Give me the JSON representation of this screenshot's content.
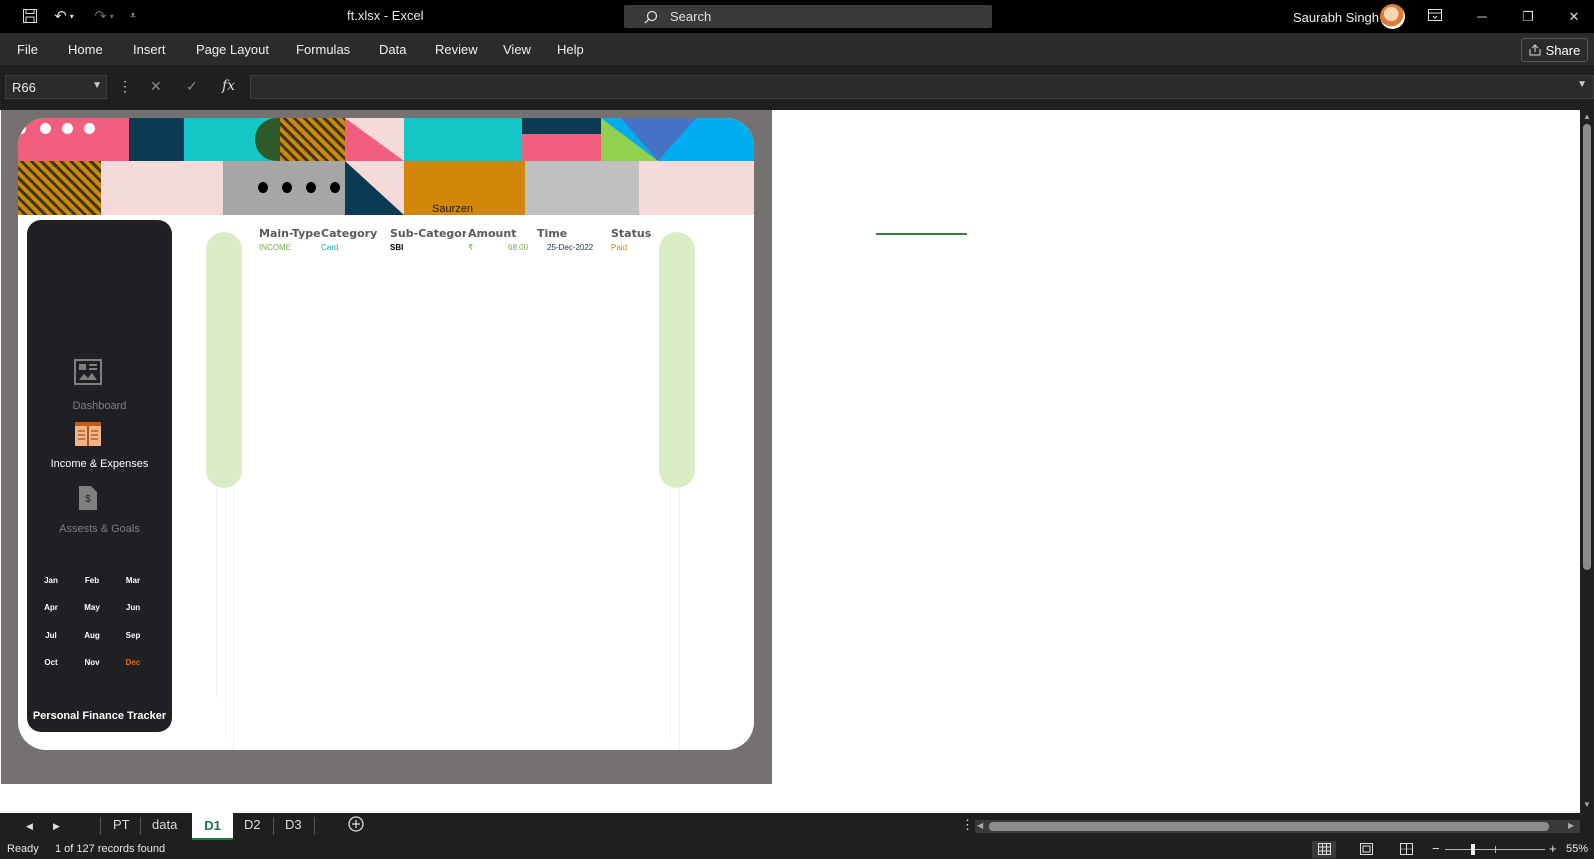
{
  "titlebar": {
    "doc_title": "ft.xlsx  -  Excel",
    "search_label": "Search",
    "user_name": "Saurabh Singh"
  },
  "ribbon": {
    "tabs": [
      "File",
      "Home",
      "Insert",
      "Page Layout",
      "Formulas",
      "Data",
      "Review",
      "View",
      "Help"
    ],
    "share_label": "Share"
  },
  "formula_bar": {
    "name_box": "R66",
    "fx_label": "fx",
    "formula": ""
  },
  "dashboard": {
    "brand": "Saurzen",
    "nav": [
      {
        "label": "Dashboard",
        "active": false
      },
      {
        "label": "Income & Expenses",
        "active": true
      },
      {
        "label": "Assests & Goals",
        "active": false
      }
    ],
    "months": [
      "Jan",
      "Feb",
      "Mar",
      "Apr",
      "May",
      "Jun",
      "Jul",
      "Aug",
      "Sep",
      "Oct",
      "Nov",
      "Dec"
    ],
    "selected_month": "Dec",
    "app_title": "Personal Finance Tracker",
    "table": {
      "headers": [
        "Main-Type",
        "Category",
        "Sub-Category",
        "Amount",
        "Time",
        "Status"
      ],
      "rows": [
        {
          "main_type": "INCOME",
          "category": "Card",
          "sub_category": "SBI",
          "currency": "₹",
          "amount": "68.00",
          "time": "25-Dec-2022",
          "status": "Paid"
        }
      ]
    },
    "colors": {
      "income": "#70ad47",
      "category": "#00b0b8",
      "time": "#1f3864",
      "status": "#bf8f00",
      "selected_month": "#e26b0a"
    }
  },
  "sheet_tabs": {
    "tabs": [
      "PT",
      "data",
      "D1",
      "D2",
      "D3"
    ],
    "active": "D1"
  },
  "status_bar": {
    "ready": "Ready",
    "records": "1 of 127 records found",
    "zoom": "55%"
  }
}
